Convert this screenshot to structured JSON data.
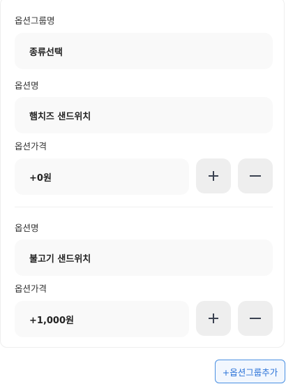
{
  "group": {
    "label": "옵션그룹명",
    "value": "종류선택"
  },
  "options": [
    {
      "name_label": "옵션명",
      "name_value": "햄치즈 샌드위치",
      "price_label": "옵션가격",
      "price_value": "+0원"
    },
    {
      "name_label": "옵션명",
      "name_value": "불고기 샌드위치",
      "price_label": "옵션가격",
      "price_value": "+1,000원"
    }
  ],
  "icons": {
    "add": "plus-icon",
    "remove": "minus-icon"
  },
  "add_group_label": "+옵션그룹추가",
  "colors": {
    "accent": "#2b73d8"
  }
}
